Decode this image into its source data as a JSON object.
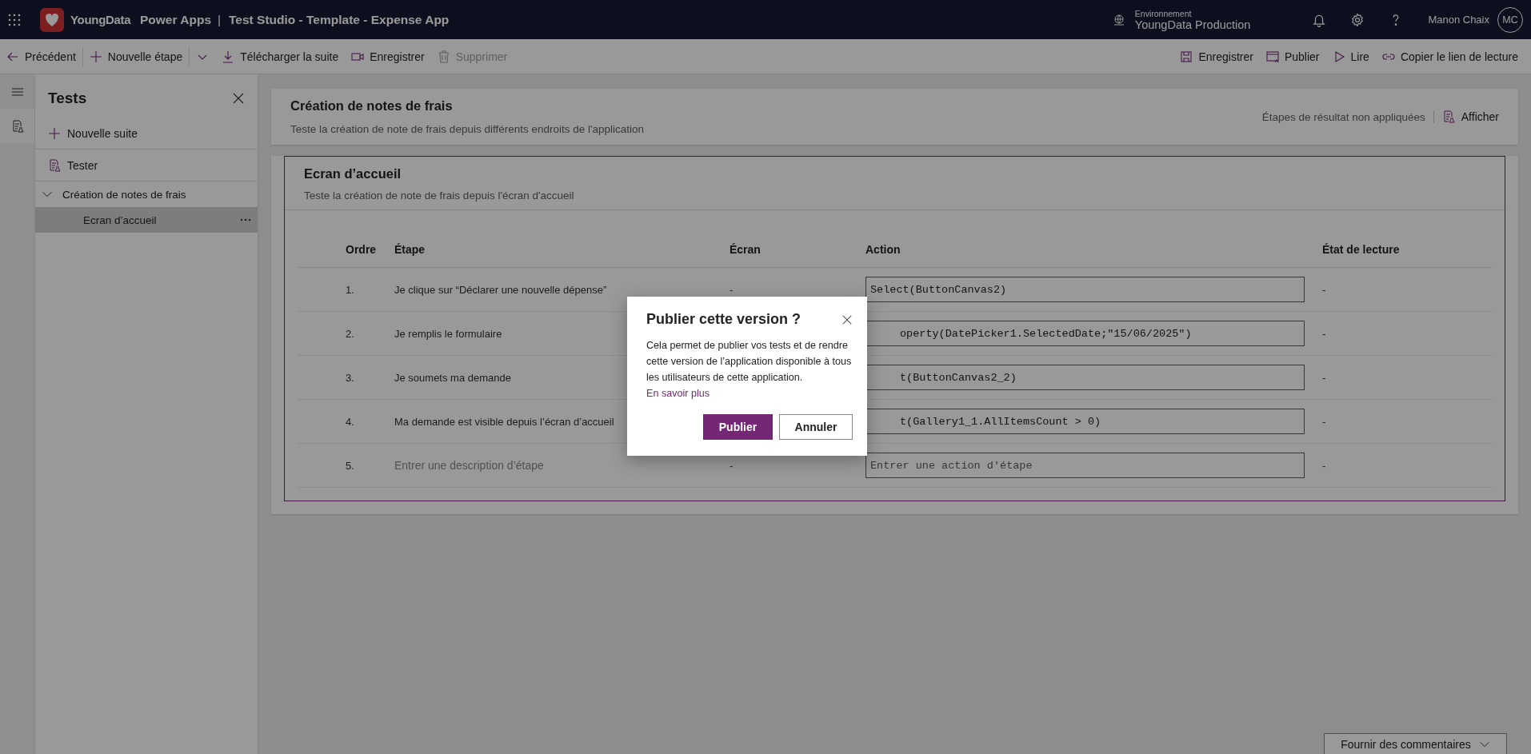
{
  "app_bar": {
    "brand": "YoungData",
    "product": "Power Apps",
    "separator": "|",
    "title": "Test Studio - Template - Expense App",
    "environment_label": "Environnement",
    "environment": "YoungData Production",
    "user": "Manon Chaix",
    "avatar_initials": "MC"
  },
  "toolbar": {
    "left": [
      {
        "kind": "back",
        "label": "Précédent",
        "disabled": false
      },
      {
        "kind": "add",
        "label": "Nouvelle étape",
        "disabled": false
      },
      {
        "kind": "dropdown",
        "disabled": false
      },
      {
        "kind": "download",
        "label": "Télécharger la suite",
        "disabled": false
      },
      {
        "kind": "record",
        "label": "Enregistrer",
        "disabled": false
      },
      {
        "kind": "delete",
        "label": "Supprimer",
        "disabled": true
      }
    ],
    "right": [
      {
        "kind": "save",
        "label": "Enregistrer",
        "disabled": false
      },
      {
        "kind": "publish",
        "label": "Publier",
        "disabled": false
      },
      {
        "kind": "play",
        "label": "Lire",
        "disabled": false
      },
      {
        "kind": "link",
        "label": "Copier le lien de lecture",
        "disabled": false
      }
    ]
  },
  "sidebar": {
    "title": "Tests",
    "new_suite": "Nouvelle suite",
    "tester": "Tester",
    "tree": [
      {
        "label": "Création de notes de frais",
        "expanded": true,
        "selected": false,
        "children": [
          {
            "label": "Ecran d’accueil",
            "selected": true
          }
        ]
      }
    ]
  },
  "suite_header": {
    "title": "Création de notes de frais",
    "description": "Teste la création de note de frais depuis différents endroits de l'application",
    "status": "Étapes de résultat non appliquées",
    "view_button": "Afficher"
  },
  "test_case": {
    "title": "Ecran d’accueil",
    "description": "Teste la création de note de frais depuis l'écran d'accueil",
    "columns": [
      "Ordre",
      "Étape",
      "Écran",
      "Action",
      "État de lecture"
    ],
    "rows": [
      {
        "order": "1.",
        "step": "Je clique sur “Déclarer une nouvelle dépense”",
        "screen": "-",
        "action": "Select(ButtonCanvas2)",
        "action_covered": false,
        "status": "-"
      },
      {
        "order": "2.",
        "step": "Je remplis le formulaire",
        "action": "operty(DatePicker1.SelectedDate;\"15/06/2025\")",
        "action_covered": true,
        "status": "-"
      },
      {
        "order": "3.",
        "step": "Je soumets ma demande",
        "action": "t(ButtonCanvas2_2)",
        "action_covered": true,
        "status": "-"
      },
      {
        "order": "4.",
        "step": "Ma demande est visible depuis l’écran d’accueil",
        "action": "t(Gallery1_1.AllItemsCount > 0)",
        "action_covered": true,
        "status": "-"
      },
      {
        "order": "5.",
        "step_placeholder": "Entrer une description d’étape",
        "screen": "-",
        "action_placeholder": "Entrer une action d'étape",
        "action_covered": false,
        "status": "-"
      }
    ]
  },
  "feedback": {
    "label": "Fournir des commentaires"
  },
  "dialog": {
    "title": "Publier cette version ?",
    "body": "Cela permet de publier vos tests et de rendre cette version de l’application disponible à tous les utilisateurs de cette application.",
    "link": "En savoir plus",
    "primary": "Publier",
    "secondary": "Annuler"
  }
}
